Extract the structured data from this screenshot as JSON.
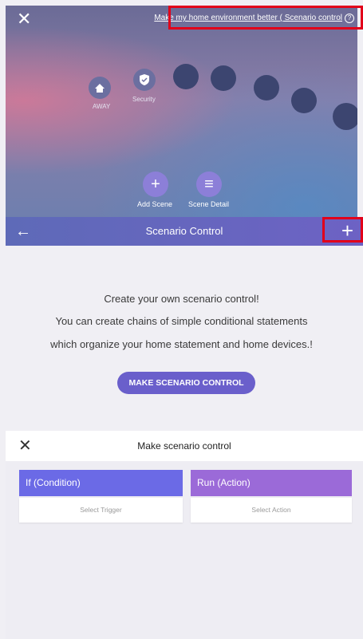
{
  "top": {
    "close_icon": "close-icon",
    "link_text": "Make my home environment better ( Scenario control",
    "info_icon_glyph": "?",
    "scenes": [
      {
        "label": "AWAY",
        "icon": "home-icon"
      },
      {
        "label": "Security",
        "icon": "shield-icon"
      }
    ],
    "actions": {
      "add_label": "Add Scene",
      "add_glyph": "+",
      "detail_label": "Scene Detail",
      "detail_glyph": "≡"
    }
  },
  "header": {
    "title": "Scenario Control",
    "back_icon": "back-arrow-icon",
    "add_icon": "plus-icon",
    "add_glyph": "+",
    "background": "#5e6ab8"
  },
  "info": {
    "line1": "Create your own scenario control!",
    "line2": "You can create chains of simple conditional statements",
    "line3": "which organize your home statement and home devices.!",
    "button": "MAKE SCENARIO CONTROL",
    "button_color": "#6a5fcb"
  },
  "make": {
    "title": "Make scenario control",
    "close_icon": "close-icon",
    "condition": {
      "label": "If (Condition)",
      "placeholder": "Select Trigger",
      "color": "#6b6ae6"
    },
    "action": {
      "label": "Run (Action)",
      "placeholder": "Select Action",
      "color": "#9b6ad8"
    }
  },
  "highlight_color": "#e2001a"
}
